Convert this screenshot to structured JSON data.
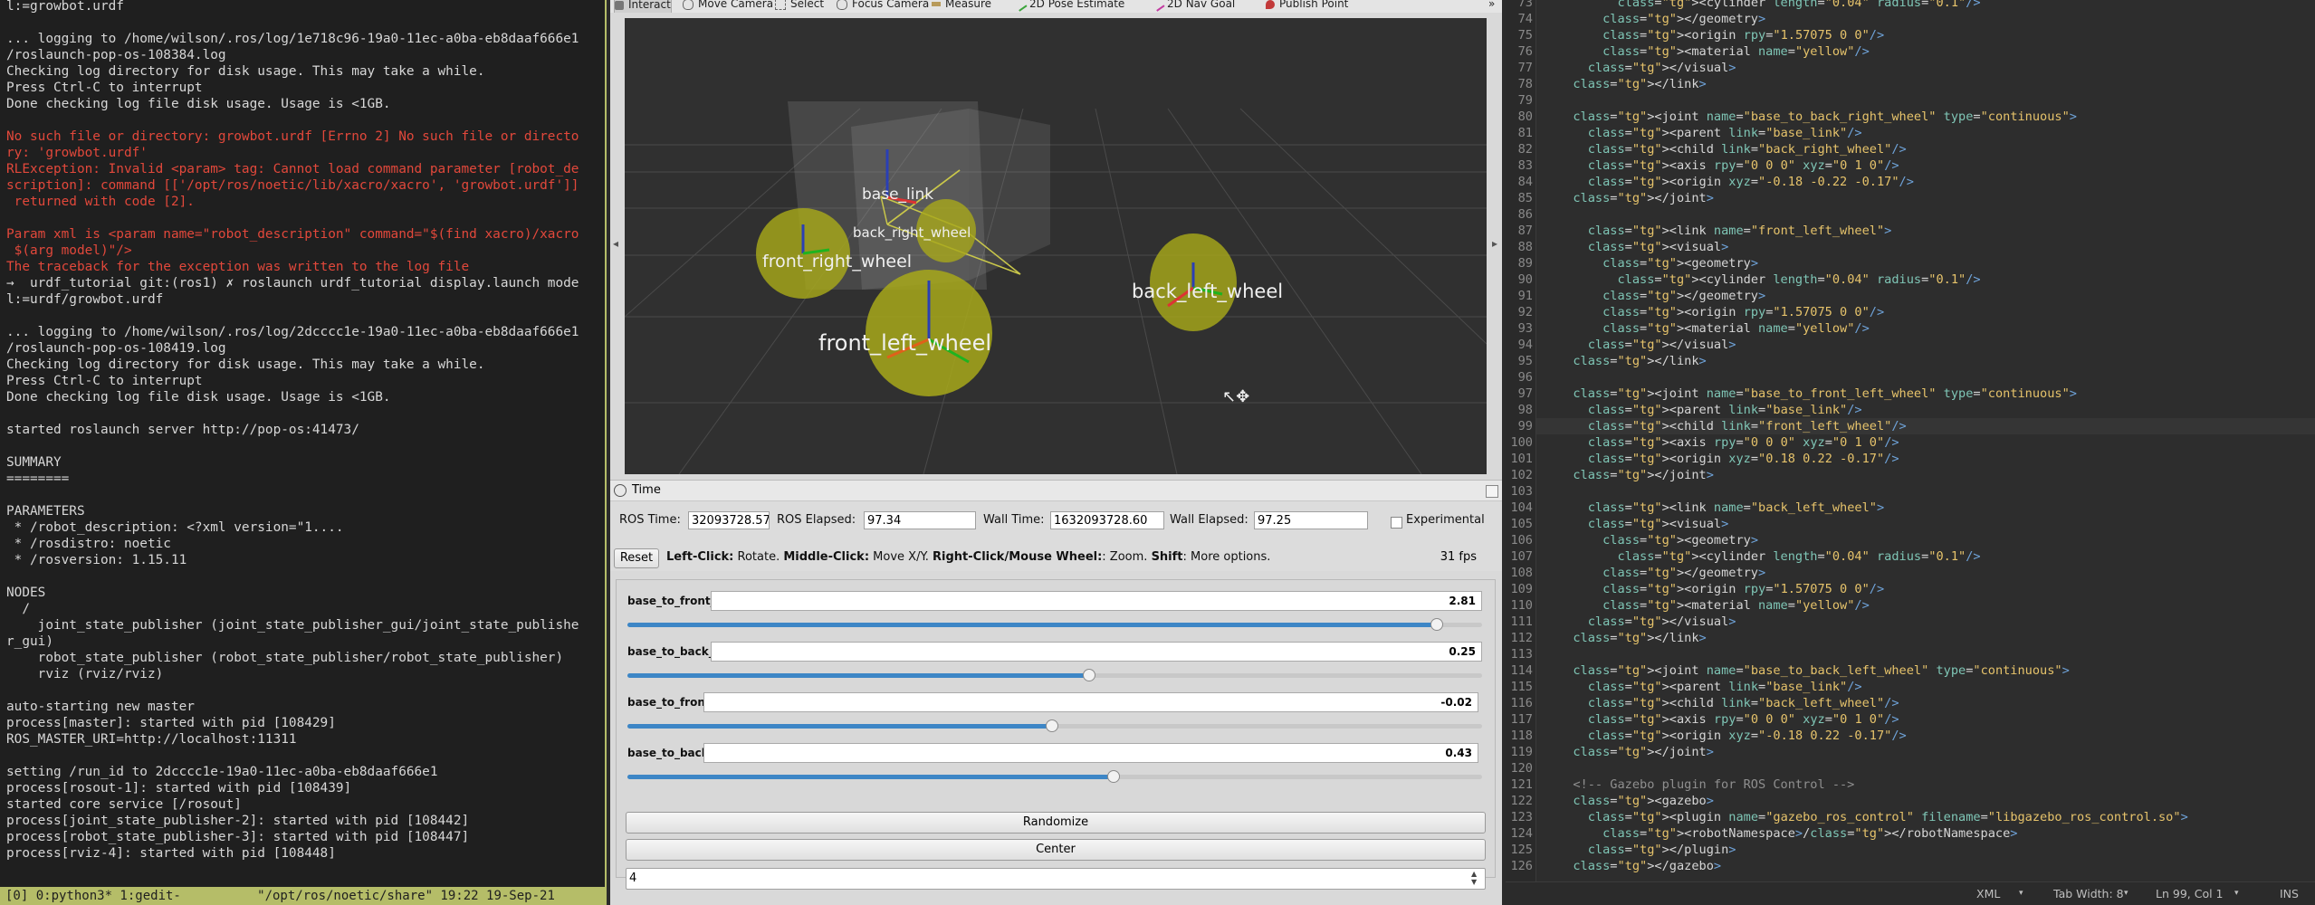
{
  "terminal": {
    "lines": [
      {
        "t": "l:=growbot.urdf",
        "c": ""
      },
      {
        "t": "",
        "c": ""
      },
      {
        "t": "... logging to /home/wilson/.ros/log/1e718c96-19a0-11ec-a0ba-eb8daaf666e1",
        "c": ""
      },
      {
        "t": "/roslaunch-pop-os-108384.log",
        "c": ""
      },
      {
        "t": "Checking log directory for disk usage. This may take a while.",
        "c": ""
      },
      {
        "t": "Press Ctrl-C to interrupt",
        "c": ""
      },
      {
        "t": "Done checking log file disk usage. Usage is <1GB.",
        "c": ""
      },
      {
        "t": "",
        "c": ""
      },
      {
        "t": "No such file or directory: growbot.urdf [Errno 2] No such file or directo",
        "c": "err"
      },
      {
        "t": "ry: 'growbot.urdf'",
        "c": "err"
      },
      {
        "t": "RLException: Invalid <param> tag: Cannot load command parameter [robot_de",
        "c": "err"
      },
      {
        "t": "scription]: command [['/opt/ros/noetic/lib/xacro/xacro', 'growbot.urdf']]",
        "c": "err"
      },
      {
        "t": " returned with code [2].",
        "c": "err"
      },
      {
        "t": "",
        "c": ""
      },
      {
        "t": "Param xml is <param name=\"robot_description\" command=\"$(find xacro)/xacro",
        "c": "err"
      },
      {
        "t": " $(arg model)\"/>",
        "c": "err"
      },
      {
        "t": "The traceback for the exception was written to the log file",
        "c": "err"
      },
      {
        "t": "→  urdf_tutorial git:(ros1) ✗ roslaunch urdf_tutorial display.launch mode",
        "c": ""
      },
      {
        "t": "l:=urdf/growbot.urdf",
        "c": ""
      },
      {
        "t": "",
        "c": ""
      },
      {
        "t": "... logging to /home/wilson/.ros/log/2dcccc1e-19a0-11ec-a0ba-eb8daaf666e1",
        "c": ""
      },
      {
        "t": "/roslaunch-pop-os-108419.log",
        "c": ""
      },
      {
        "t": "Checking log directory for disk usage. This may take a while.",
        "c": ""
      },
      {
        "t": "Press Ctrl-C to interrupt",
        "c": ""
      },
      {
        "t": "Done checking log file disk usage. Usage is <1GB.",
        "c": ""
      },
      {
        "t": "",
        "c": ""
      },
      {
        "t": "started roslaunch server http://pop-os:41473/",
        "c": ""
      },
      {
        "t": "",
        "c": ""
      },
      {
        "t": "SUMMARY",
        "c": ""
      },
      {
        "t": "========",
        "c": ""
      },
      {
        "t": "",
        "c": ""
      },
      {
        "t": "PARAMETERS",
        "c": ""
      },
      {
        "t": " * /robot_description: <?xml version=\"1....",
        "c": ""
      },
      {
        "t": " * /rosdistro: noetic",
        "c": ""
      },
      {
        "t": " * /rosversion: 1.15.11",
        "c": ""
      },
      {
        "t": "",
        "c": ""
      },
      {
        "t": "NODES",
        "c": ""
      },
      {
        "t": "  /",
        "c": ""
      },
      {
        "t": "    joint_state_publisher (joint_state_publisher_gui/joint_state_publishe",
        "c": ""
      },
      {
        "t": "r_gui)",
        "c": ""
      },
      {
        "t": "    robot_state_publisher (robot_state_publisher/robot_state_publisher)",
        "c": ""
      },
      {
        "t": "    rviz (rviz/rviz)",
        "c": ""
      },
      {
        "t": "",
        "c": ""
      },
      {
        "t": "auto-starting new master",
        "c": ""
      },
      {
        "t": "process[master]: started with pid [108429]",
        "c": ""
      },
      {
        "t": "ROS_MASTER_URI=http://localhost:11311",
        "c": ""
      },
      {
        "t": "",
        "c": ""
      },
      {
        "t": "setting /run_id to 2dcccc1e-19a0-11ec-a0ba-eb8daaf666e1",
        "c": ""
      },
      {
        "t": "process[rosout-1]: started with pid [108439]",
        "c": ""
      },
      {
        "t": "started core service [/rosout]",
        "c": ""
      },
      {
        "t": "process[joint_state_publisher-2]: started with pid [108442]",
        "c": ""
      },
      {
        "t": "process[robot_state_publisher-3]: started with pid [108447]",
        "c": ""
      },
      {
        "t": "process[rviz-4]: started with pid [108448]",
        "c": ""
      }
    ],
    "tmux_status": "[0] 0:python3* 1:gedit-          \"/opt/ros/noetic/share\" 19:22 19-Sep-21"
  },
  "rviz": {
    "toolbar": [
      "Interact",
      "Move Camera",
      "Select",
      "Focus Camera",
      "Measure",
      "2D Pose Estimate",
      "2D Nav Goal",
      "Publish Point"
    ],
    "viewport_labels": {
      "front_right": "front_right_wheel",
      "front_left": "front_left_wheel",
      "back_left": "back_left_wheel",
      "back_right": "back_right_wheel",
      "base": "base_link"
    },
    "time": {
      "title": "Time",
      "ros_time_label": "ROS Time:",
      "ros_time": "32093728.57",
      "ros_elapsed_label": "ROS Elapsed:",
      "ros_elapsed": "97.34",
      "wall_time_label": "Wall Time:",
      "wall_time": "1632093728.60",
      "wall_elapsed_label": "Wall Elapsed:",
      "wall_elapsed": "97.25",
      "experimental_label": "Experimental"
    },
    "reset_label": "Reset",
    "help": {
      "left": "Left-Click:",
      "left_desc": " Rotate. ",
      "middle": "Middle-Click:",
      "middle_desc": " Move X/Y. ",
      "right": "Right-Click/Mouse Wheel:",
      "right_desc": ": Zoom. ",
      "shift": "Shift",
      "shift_desc": ": More options."
    },
    "fps": "31 fps"
  },
  "joints": [
    {
      "name": "base_to_front_right_wheel",
      "value": "2.81",
      "fraction": 0.947
    },
    {
      "name": "base_to_back_right_wheel",
      "value": "0.25",
      "fraction": 0.54
    },
    {
      "name": "base_to_front_left_wheel",
      "value": "-0.02",
      "fraction": 0.497
    },
    {
      "name": "base_to_back_left_wheel",
      "value": "0.43",
      "fraction": 0.569
    }
  ],
  "jsp": {
    "randomize_label": "Randomize",
    "center_label": "Center",
    "spin_value": "4"
  },
  "gedit": {
    "first_line": 73,
    "current_line": 99,
    "lines": [
      "        <cylinder length=\"0.04\" radius=\"0.1\"/>",
      "      </geometry>",
      "      <origin rpy=\"1.57075 0 0\"/>",
      "      <material name=\"yellow\"/>",
      "    </visual>",
      "  </link>",
      "",
      "  <joint name=\"base_to_back_right_wheel\" type=\"continuous\">",
      "    <parent link=\"base_link\"/>",
      "    <child link=\"back_right_wheel\"/>",
      "    <axis rpy=\"0 0 0\" xyz=\"0 1 0\"/>",
      "    <origin xyz=\"-0.18 -0.22 -0.17\"/>",
      "  </joint>",
      "",
      "    <link name=\"front_left_wheel\">",
      "    <visual>",
      "      <geometry>",
      "        <cylinder length=\"0.04\" radius=\"0.1\"/>",
      "      </geometry>",
      "      <origin rpy=\"1.57075 0 0\"/>",
      "      <material name=\"yellow\"/>",
      "    </visual>",
      "  </link>",
      "",
      "  <joint name=\"base_to_front_left_wheel\" type=\"continuous\">",
      "    <parent link=\"base_link\"/>",
      "    <child link=\"front_left_wheel\"/>",
      "    <axis rpy=\"0 0 0\" xyz=\"0 1 0\"/>",
      "    <origin xyz=\"0.18 0.22 -0.17\"/>",
      "  </joint>",
      "",
      "    <link name=\"back_left_wheel\">",
      "    <visual>",
      "      <geometry>",
      "        <cylinder length=\"0.04\" radius=\"0.1\"/>",
      "      </geometry>",
      "      <origin rpy=\"1.57075 0 0\"/>",
      "      <material name=\"yellow\"/>",
      "    </visual>",
      "  </link>",
      "",
      "  <joint name=\"base_to_back_left_wheel\" type=\"continuous\">",
      "    <parent link=\"base_link\"/>",
      "    <child link=\"back_left_wheel\"/>",
      "    <axis rpy=\"0 0 0\" xyz=\"0 1 0\"/>",
      "    <origin xyz=\"-0.18 0.22 -0.17\"/>",
      "  </joint>",
      "",
      "  <!-- Gazebo plugin for ROS Control -->",
      "  <gazebo>",
      "    <plugin name=\"gazebo_ros_control\" filename=\"libgazebo_ros_control.so\">",
      "      <robotNamespace>/</robotNamespace>",
      "    </plugin>",
      "  </gazebo>"
    ],
    "status": {
      "language": "XML",
      "tab_width": "Tab Width: 8",
      "position": "Ln 99, Col 1",
      "mode": "INS"
    }
  },
  "colors": {
    "wheel": "#a7a81a",
    "terminal_error": "#e2483b",
    "tmux_bar": "#b5bd68",
    "slider_fill": "#3d86c6"
  }
}
